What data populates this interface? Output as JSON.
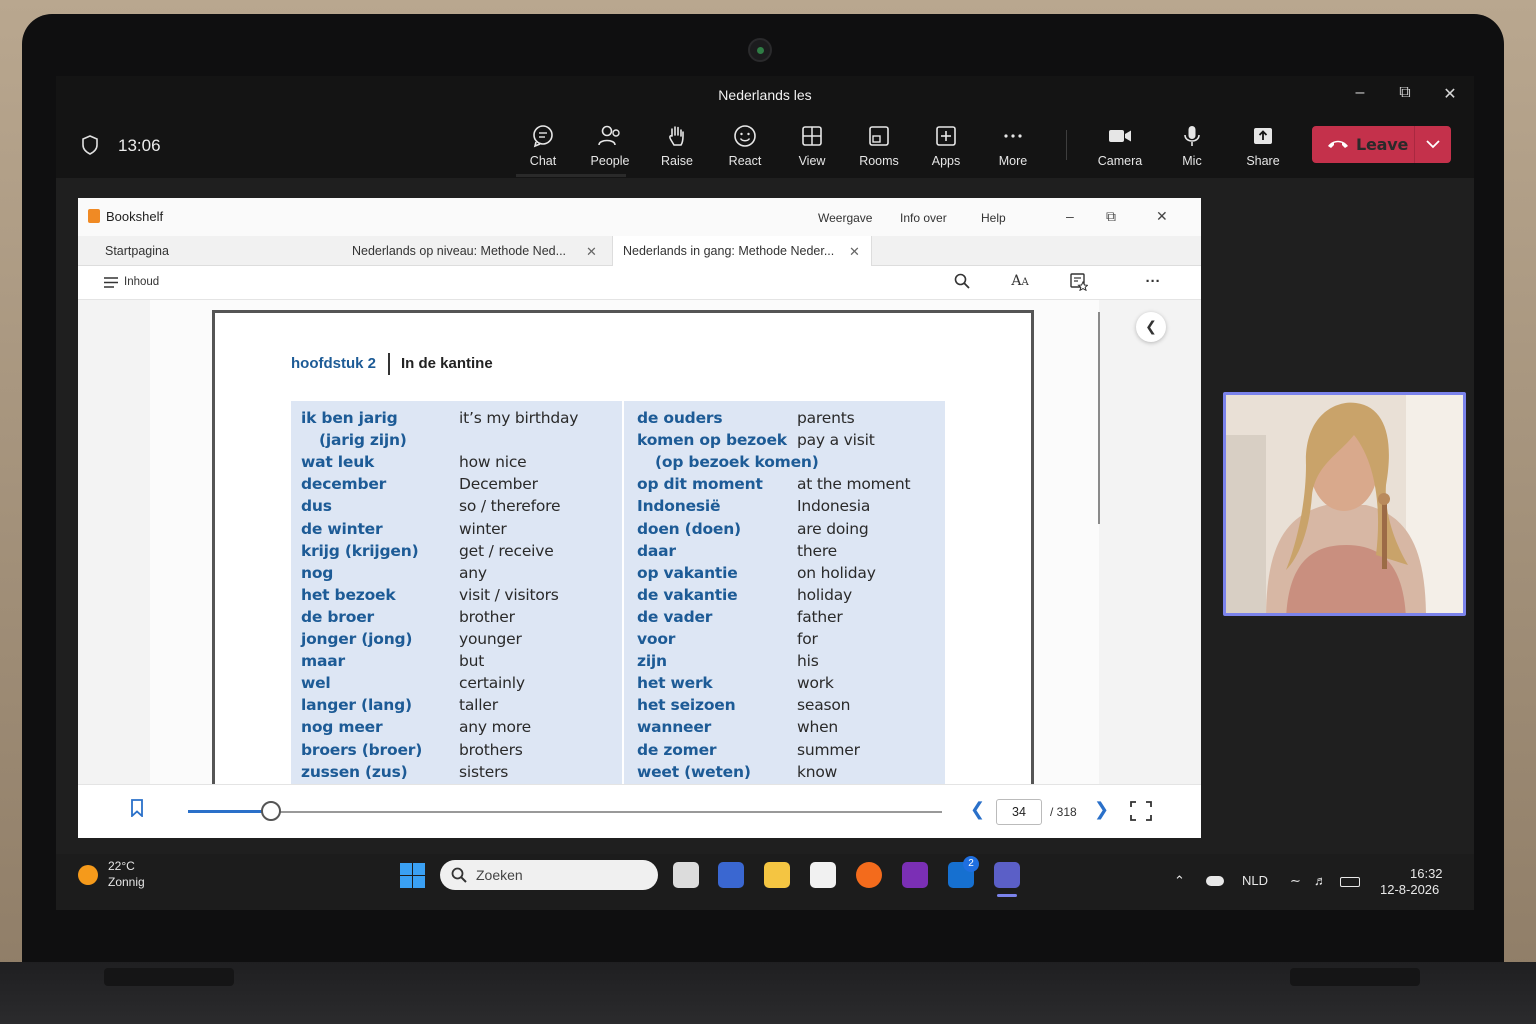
{
  "window": {
    "title": "Nederlands les"
  },
  "meeting": {
    "time": "13:06",
    "buttons": [
      {
        "label": "Chat",
        "icon": "chat-icon"
      },
      {
        "label": "People",
        "icon": "people-icon"
      },
      {
        "label": "Raise",
        "icon": "hand-icon"
      },
      {
        "label": "React",
        "icon": "smiley-icon"
      },
      {
        "label": "View",
        "icon": "grid-icon"
      },
      {
        "label": "Rooms",
        "icon": "rooms-icon"
      },
      {
        "label": "Apps",
        "icon": "plus-box-icon"
      },
      {
        "label": "More",
        "icon": "ellipsis-icon"
      },
      {
        "label": "Camera",
        "icon": "camera-icon"
      },
      {
        "label": "Mic",
        "icon": "mic-icon"
      },
      {
        "label": "Share",
        "icon": "share-icon"
      }
    ],
    "leave_label": "Leave",
    "leave_color": "#c4314b"
  },
  "bookshelf": {
    "app_name": "Bookshelf",
    "menu": [
      "Weergave",
      "Info over",
      "Help"
    ],
    "tabs": [
      {
        "label": "Startpagina"
      },
      {
        "label": "Nederlands op niveau: Methode Ned..."
      },
      {
        "label": "Nederlands in gang: Methode Neder..."
      }
    ],
    "toc_label": "Inhoud",
    "chapter": "hoofdstuk 2",
    "chapter_title": "In de kantine",
    "vocab_left": [
      {
        "nl": "ik ben jarig",
        "en": "it’s my birthday"
      },
      {
        "nl": "(jarig zijn)",
        "en": ""
      },
      {
        "nl": "wat leuk",
        "en": "how nice"
      },
      {
        "nl": "december",
        "en": "December"
      },
      {
        "nl": "dus",
        "en": "so / therefore"
      },
      {
        "nl": "de winter",
        "en": "winter"
      },
      {
        "nl": "krijg (krijgen)",
        "en": "get / receive"
      },
      {
        "nl": "nog",
        "en": "any"
      },
      {
        "nl": "het bezoek",
        "en": "visit / visitors"
      },
      {
        "nl": "de broer",
        "en": "brother"
      },
      {
        "nl": "jonger (jong)",
        "en": "younger"
      },
      {
        "nl": "maar",
        "en": "but"
      },
      {
        "nl": "wel",
        "en": "certainly"
      },
      {
        "nl": "langer (lang)",
        "en": "taller"
      },
      {
        "nl": "nog meer",
        "en": "any more"
      },
      {
        "nl": "broers (broer)",
        "en": "brothers"
      },
      {
        "nl": "zussen (zus)",
        "en": "sisters"
      }
    ],
    "vocab_right": [
      {
        "nl": "de ouders",
        "en": "parents"
      },
      {
        "nl": "komen op bezoek",
        "en": "pay a visit"
      },
      {
        "nl": "(op bezoek komen)",
        "en": ""
      },
      {
        "nl": "op dit moment",
        "en": "at the moment"
      },
      {
        "nl": "Indonesië",
        "en": "Indonesia"
      },
      {
        "nl": "doen (doen)",
        "en": "are doing"
      },
      {
        "nl": "daar",
        "en": "there"
      },
      {
        "nl": "op vakantie",
        "en": "on holiday"
      },
      {
        "nl": "de vakantie",
        "en": "holiday"
      },
      {
        "nl": "de vader",
        "en": "father"
      },
      {
        "nl": "voor",
        "en": "for"
      },
      {
        "nl": "zijn",
        "en": "his"
      },
      {
        "nl": "het werk",
        "en": "work"
      },
      {
        "nl": "het seizoen",
        "en": "season"
      },
      {
        "nl": "wanneer",
        "en": "when"
      },
      {
        "nl": "de zomer",
        "en": "summer"
      },
      {
        "nl": "weet (weten)",
        "en": "know"
      }
    ],
    "page_current": "34",
    "page_total": "/ 318",
    "progress_fraction": 0.11
  },
  "taskbar": {
    "temperature": "22°C",
    "weather": "Zonnig",
    "search_placeholder": "Zoeken",
    "language": "NLD",
    "time": "16:32",
    "date": "12-8-2026",
    "badge_count": "2"
  }
}
